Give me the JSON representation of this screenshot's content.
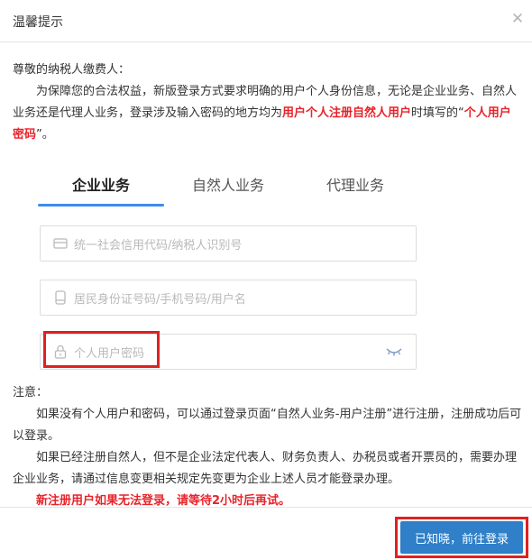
{
  "header": {
    "title": "温馨提示"
  },
  "notice": {
    "greeting": "尊敬的纳税人缴费人：",
    "line1_part1": "为保障您的合法权益，新版登录方式要求明确的用户个人身份信息，无论是企业业务、自然人业务还是代理人业务，登录涉及输入密码的地方均为",
    "line1_highlight": "用户个人注册自然人用户",
    "line1_part2": "时填写的“",
    "line1_highlight2": "个人用户密码",
    "line1_part3": "”。"
  },
  "tabs": [
    {
      "label": "企业业务",
      "active": true
    },
    {
      "label": "自然人业务",
      "active": false
    },
    {
      "label": "代理业务",
      "active": false
    }
  ],
  "form": {
    "credit_code_placeholder": "统一社会信用代码/纳税人识别号",
    "id_placeholder": "居民身份证号码/手机号码/用户名",
    "password_placeholder": "个人用户密码"
  },
  "note": {
    "title": "注意：",
    "para1": "如果没有个人用户和密码，可以通过登录页面“自然人业务-用户注册”进行注册，注册成功后可以登录。",
    "para2": "如果已经注册自然人，但不是企业法定代表人、财务负责人、办税员或者开票员的，需要办理企业业务，请通过信息变更相关规定先变更为企业上述人员才能登录办理。",
    "para3": "新注册用户如果无法登录，请等待2小时后再试。"
  },
  "footer": {
    "confirm_label": "已知晓，前往登录"
  },
  "colors": {
    "accent": "#3e8ae8",
    "button": "#2f7fc9",
    "warning": "#e8232a"
  },
  "icons": [
    "close-icon",
    "card-icon",
    "phone-icon",
    "lock-icon",
    "eye-closed-icon"
  ]
}
